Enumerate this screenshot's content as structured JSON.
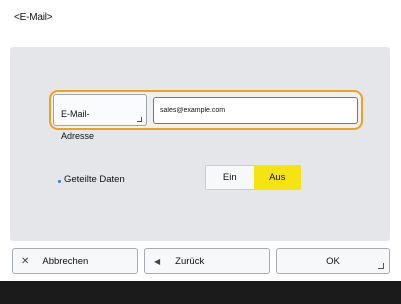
{
  "screen": {
    "title": "<E-Mail>"
  },
  "email": {
    "label_line1": "E-Mail-",
    "label_line2": "Adresse",
    "value": "sales@example.com"
  },
  "shared_data": {
    "label": "Geteilte Daten",
    "option_on": "Ein",
    "option_off": "Aus",
    "selected": "Aus"
  },
  "footer": {
    "cancel_label": "Abbrechen",
    "cancel_icon": "close-icon",
    "back_label": "Zurück",
    "back_icon": "arrow-left-icon",
    "ok_label": "OK"
  },
  "colors": {
    "highlight": "#f0a21a",
    "selected": "#f6e411",
    "bullet": "#2a80d6",
    "status_bar": "#1b1b1b"
  }
}
